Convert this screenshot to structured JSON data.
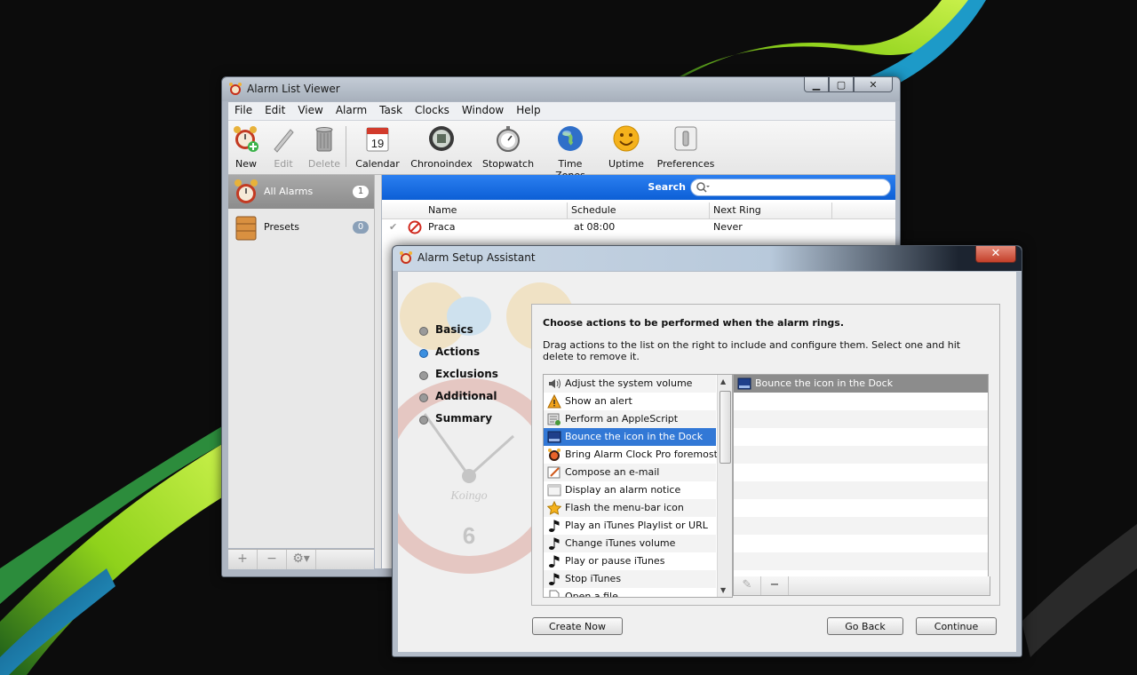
{
  "viewer": {
    "title": "Alarm List Viewer",
    "menu": [
      "File",
      "Edit",
      "View",
      "Alarm",
      "Task",
      "Clocks",
      "Window",
      "Help"
    ],
    "toolbar": {
      "new": "New",
      "edit": "Edit",
      "delete": "Delete",
      "calendar": "Calendar",
      "chronoindex": "Chronoindex",
      "stopwatch": "Stopwatch",
      "timezones": "Time Zones",
      "uptime": "Uptime",
      "preferences": "Preferences",
      "calendar_day": "19"
    },
    "sidebar": [
      {
        "label": "All Alarms",
        "count": "1"
      },
      {
        "label": "Presets",
        "count": "0"
      }
    ],
    "search": {
      "label": "Search",
      "placeholder": ""
    },
    "table": {
      "headers": [
        "Name",
        "Schedule",
        "Next Ring"
      ],
      "rows": [
        {
          "name": "Praca",
          "schedule": "at 08:00",
          "next": "Never"
        }
      ]
    },
    "sb_buttons": [
      "+",
      "−",
      "⚙▾"
    ]
  },
  "assistant": {
    "title": "Alarm Setup Assistant",
    "close": "✕",
    "steps": [
      "Basics",
      "Actions",
      "Exclusions",
      "Additional",
      "Summary"
    ],
    "current_step": "Actions",
    "heading": "Choose actions to be performed when the alarm rings.",
    "description": "Drag actions to the list on the right to include and configure them. Select one and hit delete to remove it.",
    "actions": [
      {
        "label": "Adjust the system volume",
        "icon": "speaker-icon"
      },
      {
        "label": "Show an alert",
        "icon": "warning-icon"
      },
      {
        "label": "Perform an AppleScript",
        "icon": "script-icon"
      },
      {
        "label": "Bounce the icon in the Dock",
        "icon": "dock-icon"
      },
      {
        "label": "Bring Alarm Clock Pro foremost",
        "icon": "app-icon"
      },
      {
        "label": "Compose an e-mail",
        "icon": "compose-icon"
      },
      {
        "label": "Display an alarm notice",
        "icon": "notice-icon"
      },
      {
        "label": "Flash the menu-bar icon",
        "icon": "star-icon"
      },
      {
        "label": "Play an iTunes Playlist or URL",
        "icon": "music-note-icon"
      },
      {
        "label": "Change iTunes volume",
        "icon": "music-note-icon"
      },
      {
        "label": "Play or pause iTunes",
        "icon": "music-note-icon"
      },
      {
        "label": "Stop iTunes",
        "icon": "music-note-icon"
      },
      {
        "label": "Open a file",
        "icon": "file-icon"
      }
    ],
    "selected_actions": [
      {
        "label": "Bounce the icon in the Dock",
        "icon": "dock-icon"
      }
    ],
    "buttons": {
      "create_now": "Create Now",
      "go_back": "Go Back",
      "continue": "Continue"
    },
    "watermark_text": "Koingo",
    "watermark_numeral": "6"
  }
}
